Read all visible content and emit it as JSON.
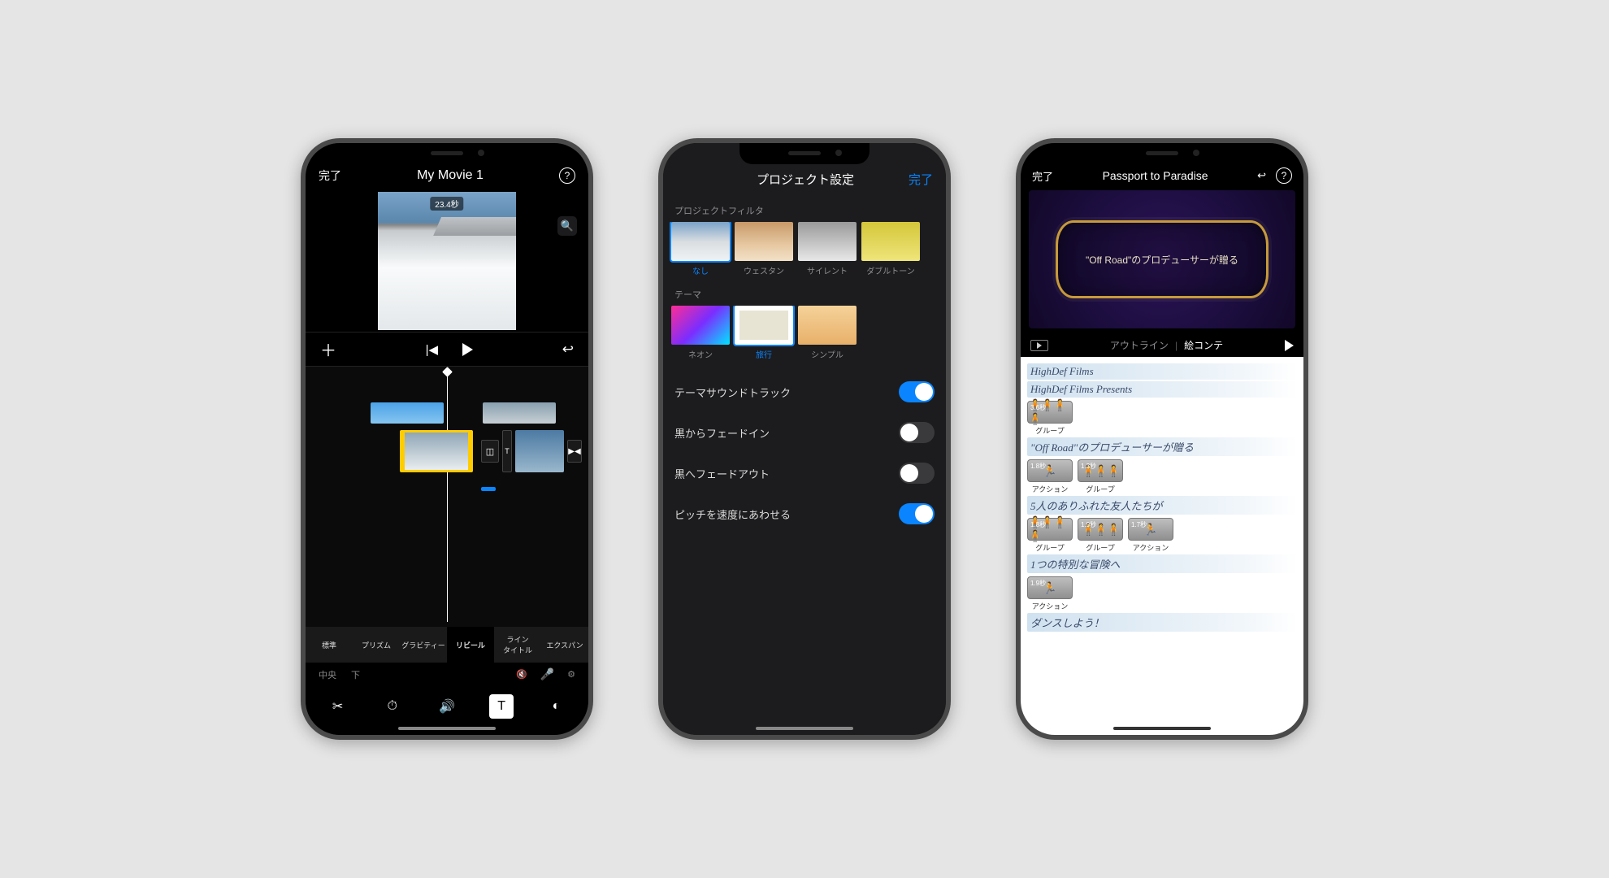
{
  "phone1": {
    "done": "完了",
    "title": "My Movie 1",
    "clip_duration": "23.4秒",
    "title_styles": [
      "標準",
      "プリズム",
      "グラビティー",
      "リビール",
      "ライン\nタイトル",
      "エクスパン"
    ],
    "title_selected_index": 3,
    "align": {
      "center": "中央",
      "bottom": "下"
    }
  },
  "phone2": {
    "title": "プロジェクト設定",
    "done": "完了",
    "filters_label": "プロジェクトフィルタ",
    "filters": [
      {
        "name": "なし",
        "key": "none"
      },
      {
        "name": "ウェスタン",
        "key": "western"
      },
      {
        "name": "サイレント",
        "key": "silent"
      },
      {
        "name": "ダブルトーン",
        "key": "duo"
      }
    ],
    "filter_selected_index": 0,
    "themes_label": "テーマ",
    "themes": [
      {
        "name": "ネオン",
        "key": "neon"
      },
      {
        "name": "旅行",
        "key": "travel"
      },
      {
        "name": "シンプル",
        "key": "simple"
      }
    ],
    "theme_selected_index": 1,
    "settings": [
      {
        "label": "テーマサウンドトラック",
        "on": true
      },
      {
        "label": "黒からフェードイン",
        "on": false
      },
      {
        "label": "黒へフェードアウト",
        "on": false
      },
      {
        "label": "ピッチを速度にあわせる",
        "on": true
      }
    ]
  },
  "phone3": {
    "done": "完了",
    "title": "Passport to Paradise",
    "preview_text": "\"Off Road\"のプロデューサーが贈る",
    "tabs": {
      "outline": "アウトライン",
      "storyboard": "絵コンテ"
    },
    "story": {
      "line1": "HighDef Films",
      "line2": "HighDef Films Presents",
      "shot1": {
        "dur": "3.6秒",
        "label": "グループ"
      },
      "line3": "\"Off Road\"のプロデューサーが贈る",
      "shot2a": {
        "dur": "1.8秒",
        "label": "アクション"
      },
      "shot2b": {
        "dur": "1.3秒",
        "label": "グループ"
      },
      "line4": "5人のありふれた友人たちが",
      "shot3a": {
        "dur": "1.8秒",
        "label": "グループ"
      },
      "shot3b": {
        "dur": "1.9秒",
        "label": "グループ"
      },
      "shot3c": {
        "dur": "1.7秒",
        "label": "アクション"
      },
      "line5": "1つの特別な冒険へ",
      "shot4": {
        "dur": "1.9秒",
        "label": "アクション"
      },
      "line6": "ダンスしよう！"
    }
  }
}
